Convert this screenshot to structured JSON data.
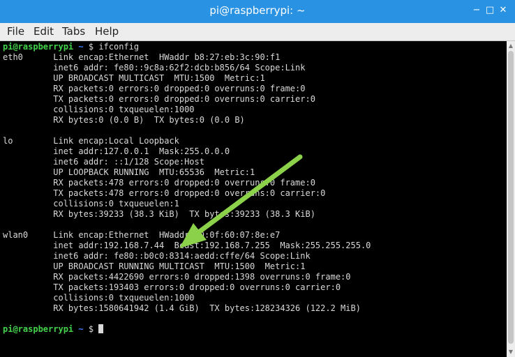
{
  "window": {
    "title": "pi@raspberrypi: ~"
  },
  "menu": [
    "File",
    "Edit",
    "Tabs",
    "Help"
  ],
  "prompt": {
    "user": "pi@raspberrypi",
    "path": "~",
    "symbol": "$",
    "command": "ifconfig"
  },
  "terminal": {
    "lines": [
      "eth0      Link encap:Ethernet  HWaddr b8:27:eb:3c:90:f1",
      "          inet6 addr: fe80::9c8a:62f2:dcb:b856/64 Scope:Link",
      "          UP BROADCAST MULTICAST  MTU:1500  Metric:1",
      "          RX packets:0 errors:0 dropped:0 overruns:0 frame:0",
      "          TX packets:0 errors:0 dropped:0 overruns:0 carrier:0",
      "          collisions:0 txqueuelen:1000",
      "          RX bytes:0 (0.0 B)  TX bytes:0 (0.0 B)",
      "",
      "lo        Link encap:Local Loopback",
      "          inet addr:127.0.0.1  Mask:255.0.0.0",
      "          inet6 addr: ::1/128 Scope:Host",
      "          UP LOOPBACK RUNNING  MTU:65536  Metric:1",
      "          RX packets:478 errors:0 dropped:0 overruns:0 frame:0",
      "          TX packets:478 errors:0 dropped:0 overruns:0 carrier:0",
      "          collisions:0 txqueuelen:1",
      "          RX bytes:39233 (38.3 KiB)  TX bytes:39233 (38.3 KiB)",
      "",
      "wlan0     Link encap:Ethernet  HWaddr 00:0f:60:07:8e:e7",
      "          inet addr:192.168.7.44  Bcast:192.168.7.255  Mask:255.255.255.0",
      "          inet6 addr: fe80::b0c0:8314:aedd:cffe/64 Scope:Link",
      "          UP BROADCAST RUNNING MULTICAST  MTU:1500  Metric:1",
      "          RX packets:4422690 errors:0 dropped:1398 overruns:0 frame:0",
      "          TX packets:193403 errors:0 dropped:0 overruns:0 carrier:0",
      "          collisions:0 txqueuelen:1000",
      "          RX bytes:1580641942 (1.4 GiB)  TX bytes:128234326 (122.2 MiB)"
    ]
  },
  "colors": {
    "titlebar": "#2a92e3",
    "prompt_user": "#43d34b",
    "prompt_path": "#3f7fff",
    "arrow": "#8bd14a"
  },
  "icons": {
    "minimize": "minimize-icon",
    "maximize": "maximize-icon",
    "close": "close-icon"
  }
}
